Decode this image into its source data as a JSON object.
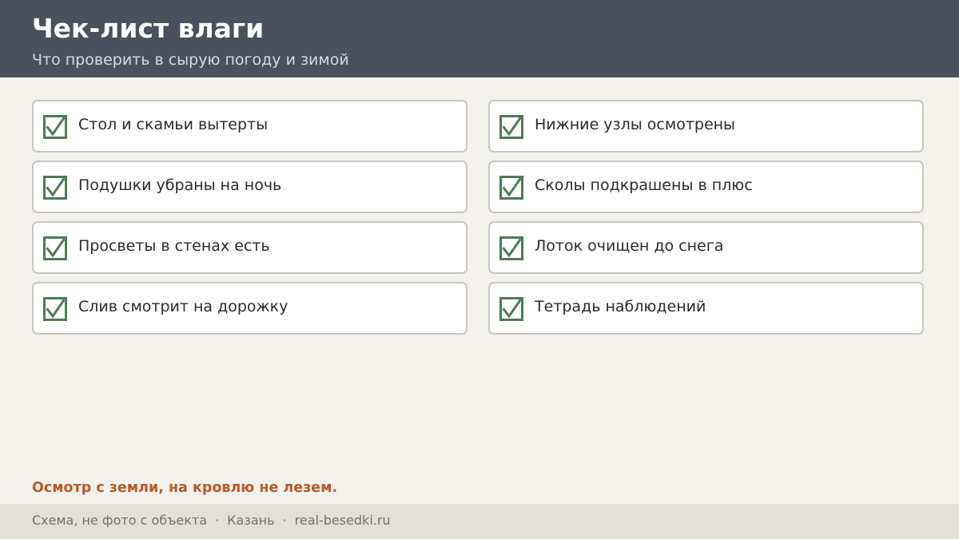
{
  "header": {
    "title": "Чек-лист влаги",
    "subtitle": "Что проверить в сырую погоду и зимой"
  },
  "checklist": [
    {
      "label": "Стол и скамьи вытерты",
      "checked": true
    },
    {
      "label": "Нижние узлы осмотрены",
      "checked": true
    },
    {
      "label": "Подушки убраны на ночь",
      "checked": true
    },
    {
      "label": "Сколы подкрашены в плюс",
      "checked": true
    },
    {
      "label": "Просветы в стенах есть",
      "checked": true
    },
    {
      "label": "Лоток очищен до снега",
      "checked": true
    },
    {
      "label": "Слив смотрит на дорожку",
      "checked": true
    },
    {
      "label": "Тетрадь наблюдений",
      "checked": true
    }
  ],
  "note": "Осмотр с земли, на кровлю не лезем.",
  "footer": {
    "items": [
      "Схема, не фото с объекта",
      "Казань",
      "real-besedki.ru"
    ],
    "separator": "·"
  },
  "colors": {
    "header_bg": "#48515d",
    "check_green": "#4e7a57",
    "note_orange": "#b85a28"
  },
  "icons": {
    "check": "checkbox-checked-icon"
  }
}
